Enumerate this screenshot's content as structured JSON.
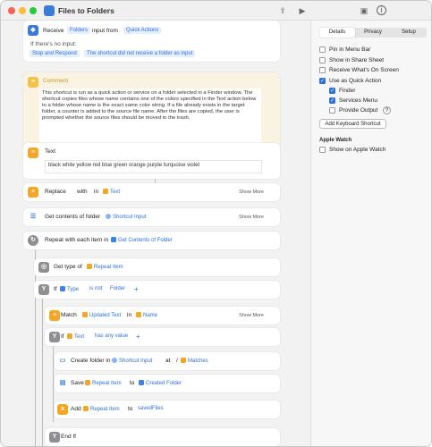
{
  "window": {
    "title": "Files to Folders"
  },
  "receive": {
    "label": "Receive",
    "what": "Folders",
    "input_from": "input from",
    "source": "Quick Actions",
    "no_input": "If there's no input:",
    "stop": "Stop and Respond",
    "message": "The shortcut did not receive a folder as input"
  },
  "comment": {
    "title": "Comment",
    "text": "This shortcut is run as a quick action or service on a folder selected in a Finder window. The shortcut copies files whose name contains one of the colors specified in the Text action below to a folder whose name is the exact same color string. If a file already exists in the target folder, a counter is added to the source file name. After the files are copied, the user is prompted whether the source files should be moved to the trash."
  },
  "text_action": {
    "title": "Text",
    "value": "black white yellow red blue green orange purple turquoise violet"
  },
  "replace": {
    "label": "Replace",
    "with": "with",
    "in": "in",
    "token": "Text",
    "more": "Show More"
  },
  "get_contents": {
    "label": "Get contents of folder",
    "token": "Shortcut Input",
    "more": "Show More"
  },
  "repeat": {
    "label": "Repeat with each item in",
    "token": "Get Contents of Folder"
  },
  "get_type": {
    "label": "Get type of",
    "token": "Repeat Item"
  },
  "if1": {
    "label": "If",
    "token": "Type",
    "cond": "is not",
    "value": "Folder",
    "plus": "+"
  },
  "match": {
    "label": "Match",
    "token": "Updated Text",
    "in": "in",
    "token2": "Name",
    "more": "Show More"
  },
  "if2": {
    "label": "If",
    "token": "Text",
    "cond": "has any value",
    "plus": "+"
  },
  "create_folder": {
    "label": "Create folder in",
    "token": "Shortcut Input",
    "at": "at",
    "slash": "/",
    "token2": "Matches"
  },
  "save": {
    "label": "Save",
    "token": "Repeat Item",
    "to": "to",
    "token2": "Created Folder"
  },
  "add": {
    "label": "Add",
    "token": "Repeat Item",
    "to": "to",
    "var": "savedFiles"
  },
  "end_if": {
    "label": "End If"
  },
  "sidebar": {
    "tabs": [
      "Details",
      "Privacy",
      "Setup"
    ],
    "pin": "Pin in Menu Bar",
    "share": "Show in Share Sheet",
    "receive_screen": "Receive What's On Screen",
    "quick_action": "Use as Quick Action",
    "finder": "Finder",
    "services": "Services Menu",
    "provide_output": "Provide Output",
    "help": "?",
    "add_shortcut": "Add Keyboard Shortcut",
    "apple_watch": "Apple Watch",
    "show_watch": "Show on Apple Watch"
  },
  "colors": {
    "accent": "#2d70d8",
    "orange": "#f5a623",
    "gray": "#8e8e93",
    "blue": "#3b82f6"
  }
}
